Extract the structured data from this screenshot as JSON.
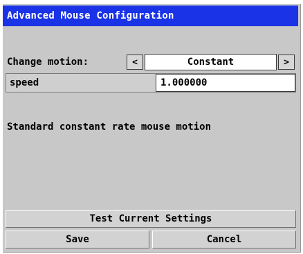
{
  "window": {
    "title": "Advanced Mouse Configuration"
  },
  "motion": {
    "label": "Change motion:",
    "prev_icon": "<",
    "next_icon": ">",
    "value": "Constant"
  },
  "params": {
    "speed_label": "speed",
    "speed_value": "1.000000"
  },
  "description": "Standard constant rate mouse motion",
  "buttons": {
    "test": "Test Current Settings",
    "save": "Save",
    "cancel": "Cancel"
  },
  "colors": {
    "titlebar": "#1a33e6",
    "dialog_bg": "#c8c8c8",
    "field_bg": "#ffffff"
  },
  "icons": {
    "prev": "chevron-left-icon",
    "next": "chevron-right-icon"
  }
}
